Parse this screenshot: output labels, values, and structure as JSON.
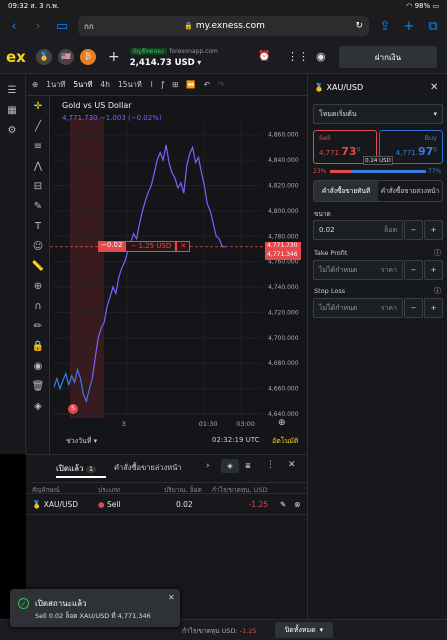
{
  "status": {
    "time": "09:32",
    "date": "ส. 3 ก.พ.",
    "battery": "98%"
  },
  "browser": {
    "tab_label": "กก",
    "url": "my.exness.com"
  },
  "app": {
    "logo": "ex",
    "account_tag": "บัญชีทดลอง",
    "server": "forexonapp.com",
    "balance": "2,414.73 USD",
    "deposit_label": "ฝากเงิน"
  },
  "chart_toolbar": {
    "timeframes": [
      "1นาที",
      "5นาที",
      "4h",
      "15นาที"
    ],
    "active_tf": "5นาที"
  },
  "chart": {
    "title": "Gold vs US Dollar",
    "ohlc_price": "4,771.730",
    "ohlc_change": "−1.003",
    "ohlc_pct": "(−0.02%)",
    "position_pl": "−0.02",
    "position_usd": "− 1.25 USD",
    "position_close": "✕",
    "marker_letter": "S",
    "bid_label": "4,771.730",
    "ask_label": "4,771.346",
    "bottom_range": "ช่วงวันที่",
    "clock": "02:32:19 UTC",
    "auto": "อัตโนมัติ",
    "up_color": "#7b61ff",
    "down_color": "#3b7ddd",
    "sell_color": "#e5484d"
  },
  "chart_data": {
    "type": "line",
    "ylim": [
      4640,
      4870
    ],
    "yticks": [
      "4,860.000",
      "4,840.000",
      "4,820.000",
      "4,800.000",
      "4,780.000",
      "4,760.000",
      "4,740.000",
      "4,720.000",
      "4,700.000",
      "4,680.000",
      "4,660.000",
      "4,640.000"
    ],
    "ytick_values": [
      4860,
      4840,
      4820,
      4800,
      4780,
      4760,
      4740,
      4720,
      4700,
      4680,
      4660,
      4640
    ],
    "xticks": [
      "3",
      "01:30",
      "03:00"
    ],
    "xtick_positions": [
      0.35,
      0.72,
      0.9
    ],
    "series": [
      {
        "values": [
          4661,
          4668,
          4660,
          4666,
          4672,
          4663,
          4670,
          4665,
          4675,
          4668,
          4655,
          4650,
          4660,
          4668
        ]
      },
      {
        "values": [
          4668,
          4685,
          4700,
          4708,
          4712,
          4725,
          4732,
          4740,
          4735,
          4748,
          4755,
          4760,
          4768,
          4775,
          4782,
          4778,
          4790,
          4800,
          4808,
          4815,
          4820,
          4830,
          4840,
          4846,
          4840,
          4852,
          4838,
          4830,
          4826,
          4818,
          4822,
          4814,
          4835,
          4845,
          4850,
          4838,
          4842,
          4830,
          4820,
          4805,
          4800,
          4790,
          4780,
          4778,
          4772,
          4771.73
        ]
      }
    ]
  },
  "order_panel": {
    "symbol": "XAU/USD",
    "order_type": "โหมดเริ่มต้น",
    "sell_label": "Sell",
    "sell_price_main": "4,771.",
    "sell_price_big": "73",
    "sell_price_sup": "0",
    "buy_label": "Buy",
    "buy_price_main": "4,771.",
    "buy_price_big": "97",
    "buy_price_sup": "0",
    "spread": "0.24 USD",
    "sell_pct": "23%",
    "buy_pct": "77%",
    "sell_pct_value": 0.23,
    "tab_market": "คำสั่งซื้อขายทันที",
    "tab_pending": "คำสั่งซื้อขายล่วงหน้า",
    "volume_label": "ขนาด",
    "volume_value": "0.02",
    "volume_unit": "ล็อต",
    "tp_label": "Take Profit",
    "tp_value": "ไม่ได้กำหนด",
    "tp_unit": "ราคา",
    "sl_label": "Stop Loss",
    "sl_value": "ไม่ได้กำหนด",
    "sl_unit": "ราคา",
    "minus": "−",
    "plus": "+"
  },
  "positions": {
    "tab_open": "เปิดแล้ว",
    "tab_open_count": "1",
    "tab_pending": "คำสั่งซื้อขายล่วงหน้า",
    "col_symbol": "สัญลักษณ์",
    "col_type": "ประเภท",
    "col_volume": "ปริมาณ, ล็อต",
    "col_pl": "กำไร/ขาดทุน, USD",
    "rows": [
      {
        "symbol": "XAU/USD",
        "type": "Sell",
        "volume": "0.02",
        "pl": "-1.25"
      }
    ]
  },
  "footer": {
    "pl_label": "กำไร/ขาดทุน USD:",
    "pl_value": "-1.25",
    "close_all": "ปิดทั้งหมด"
  },
  "toast": {
    "title": "เปิดสถานะแล้ว",
    "body": "Sell 0.02 ล็อต XAU/USD ที่ 4,771.346"
  }
}
